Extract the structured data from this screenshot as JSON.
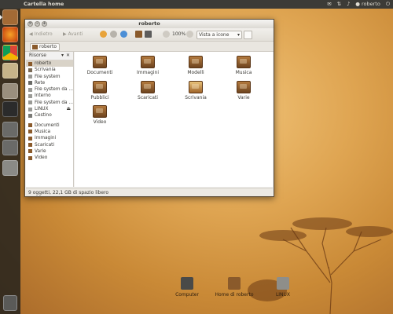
{
  "top_panel": {
    "title": "Cartella home",
    "user": "roberto"
  },
  "window": {
    "title": "roberto",
    "toolbar": {
      "back_label": "Indietro",
      "forward_label": "Avanti",
      "zoom": "100%",
      "view_mode": "Vista a icone"
    },
    "path": [
      "roberto"
    ],
    "sidebar": {
      "header": "Risorse",
      "items": [
        {
          "label": "roberto",
          "icon": "home-icon",
          "selected": true
        },
        {
          "label": "Scrivania",
          "icon": "desktop-icon"
        },
        {
          "label": "File system",
          "icon": "drive-icon"
        },
        {
          "label": "Rete",
          "icon": "network-icon"
        },
        {
          "label": "File system da ...",
          "icon": "drive-icon"
        },
        {
          "label": "Interno",
          "icon": "drive-icon"
        },
        {
          "label": "File system da ...",
          "icon": "drive-icon"
        },
        {
          "label": "LINUX",
          "icon": "drive-icon",
          "eject": true
        },
        {
          "label": "Cestino",
          "icon": "trash-icon"
        }
      ],
      "bookmarks": [
        {
          "label": "Documenti"
        },
        {
          "label": "Musica"
        },
        {
          "label": "Immagini"
        },
        {
          "label": "Scaricati"
        },
        {
          "label": "Varie"
        },
        {
          "label": "Video"
        }
      ]
    },
    "files": [
      {
        "name": "Documenti"
      },
      {
        "name": "Immagini"
      },
      {
        "name": "Modelli"
      },
      {
        "name": "Musica"
      },
      {
        "name": "Pubblici"
      },
      {
        "name": "Scaricati"
      },
      {
        "name": "Scrivania"
      },
      {
        "name": "Varie"
      },
      {
        "name": "Video"
      }
    ],
    "status": "9 oggetti, 22,1 GB di spazio libero"
  },
  "desktop_icons": [
    {
      "label": "Computer"
    },
    {
      "label": "Home di roberto"
    },
    {
      "label": "LINUX"
    }
  ],
  "colors": {
    "panel": "#3c3b37",
    "folder": "#8a5a2b",
    "accent_orange": "#dd4814"
  }
}
